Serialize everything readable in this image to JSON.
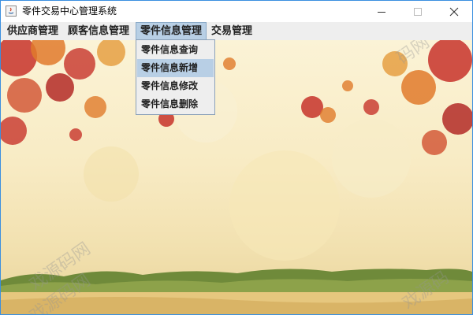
{
  "window": {
    "title": "零件交易中心管理系统",
    "controls": {
      "minimize": "—",
      "maximize": "☐",
      "close": "✕"
    }
  },
  "menubar": {
    "items": [
      {
        "label": "供应商管理"
      },
      {
        "label": "顾客信息管理"
      },
      {
        "label": "零件信息管理",
        "active": true
      },
      {
        "label": "交易管理"
      }
    ]
  },
  "dropdown": {
    "items": [
      {
        "label": "零件信息查询"
      },
      {
        "label": "零件信息新增",
        "selected": true
      },
      {
        "label": "零件信息修改"
      },
      {
        "label": "零件信息删除"
      }
    ]
  },
  "watermarks": [
    "码网",
    "戏源码网",
    "戏源码",
    "戏源码网"
  ],
  "colors": {
    "menu_highlight": "#b8cfe5",
    "menubar_bg": "#eeeeee",
    "leaf_red": "#c7332a",
    "leaf_orange": "#e07a2b",
    "background_cream": "#fbf3d6"
  }
}
